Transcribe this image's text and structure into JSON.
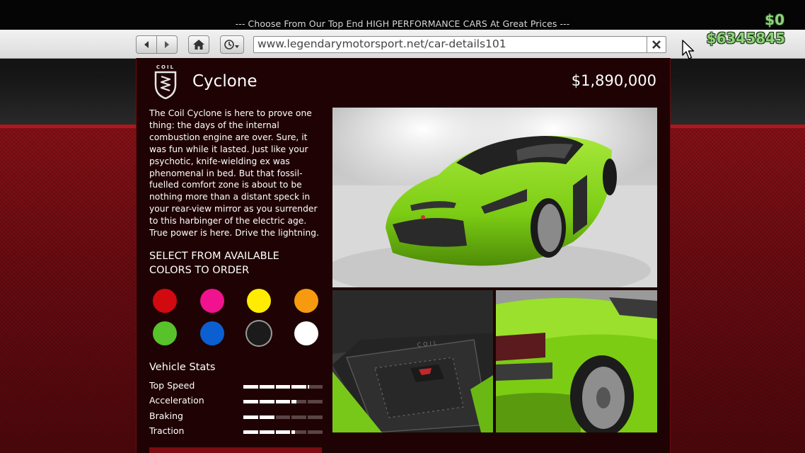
{
  "banner": {
    "text": "--- Choose From Our Top End HIGH PERFORMANCE CARS At Great Prices ---"
  },
  "browser": {
    "url": "www.legendarymotorsport.net/car-details101"
  },
  "hud": {
    "cash": "$0",
    "bank": "$6345845"
  },
  "vehicle": {
    "brand_logo_text": "COIL",
    "name": "Cyclone",
    "price": "$1,890,000",
    "description": "The Coil Cyclone is here to prove one thing: the days of the internal combustion engine are over. Sure, it was fun while it lasted. Just like your psychotic, knife-wielding ex was phenomenal in bed. But that fossil-fuelled comfort zone is about to be nothing more than a distant speck in your rear-view mirror as you surrender to this harbinger of the electric age. True power is here. Drive the lightning."
  },
  "colors": {
    "title_line1": "SELECT FROM AVAILABLE",
    "title_line2": "COLORS TO ORDER",
    "swatches": [
      {
        "name": "red",
        "hex": "#d10a0f"
      },
      {
        "name": "pink",
        "hex": "#f0128e"
      },
      {
        "name": "yellow",
        "hex": "#ffec00"
      },
      {
        "name": "orange",
        "hex": "#f79a10"
      },
      {
        "name": "green",
        "hex": "#58c22a"
      },
      {
        "name": "blue",
        "hex": "#0b5fd1"
      },
      {
        "name": "black",
        "hex": "#1b1b1b",
        "selected": true
      },
      {
        "name": "white",
        "hex": "#ffffff"
      }
    ]
  },
  "stats": {
    "title": "Vehicle Stats",
    "items": [
      {
        "label": "Top Speed",
        "value": 0.82
      },
      {
        "label": "Acceleration",
        "value": 0.66
      },
      {
        "label": "Braking",
        "value": 0.4
      },
      {
        "label": "Traction",
        "value": 0.64
      }
    ]
  },
  "theme": {
    "accent": "#8a1218",
    "panel": "#1f0304",
    "car_green": "#7fd21a",
    "money_green": "#8fd27c"
  }
}
